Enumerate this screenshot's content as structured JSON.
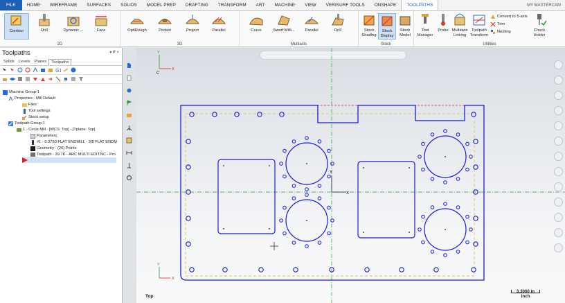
{
  "menubar": {
    "items": [
      "FILE",
      "HOME",
      "WIREFRAME",
      "SURFACES",
      "SOLIDS",
      "MODEL PREP",
      "DRAFTING",
      "TRANSFORM",
      "ART",
      "MACHINE",
      "VIEW",
      "VERISURF TOOLS",
      "ONSHAPE",
      "TOOLPATHS"
    ],
    "account": "MY MASTERCAM"
  },
  "ribbon": {
    "group_2d": {
      "label": "2D",
      "buttons": [
        "Contour",
        "Drill",
        "Dynamic ...",
        "Face"
      ]
    },
    "group_3d": {
      "label": "3D",
      "buttons": [
        "OptiRough",
        "Pocket",
        "Project",
        "Parallel"
      ]
    },
    "group_multiaxis": {
      "label": "Multiaxis",
      "buttons": [
        "Curve",
        "Swarf Milli...",
        "Parallel",
        "Drill"
      ]
    },
    "group_stock": {
      "label": "Stock",
      "buttons": [
        "Stock Shading",
        "Stock Display",
        "Stock Model"
      ]
    },
    "group_utilities": {
      "label": "Utilities",
      "buttons": [
        "Tool Manager",
        "Probe",
        "Multiaxis Linking",
        "Toolpath Transform"
      ],
      "small": [
        "Convert to 5-axis",
        "Trim",
        "Nesting"
      ],
      "check": "Check Holder"
    }
  },
  "left_panel": {
    "title": "Toolpaths",
    "pins": "▾ ₽ ×",
    "tabs": [
      "Solids",
      "Levels",
      "Planes",
      "Toolpaths"
    ],
    "tree": [
      "Machine Group-1",
      "Properties - Mill Default",
      "Files",
      "Tool settings",
      "Stock setup",
      "Toolpath Group-1",
      "1 - Circle Mill - [WCS: Top] - [Tplane: Top]",
      "Parameters",
      "#1 - 0.3750 FLAT ENDMILL - 3/8 FLAT ENDM",
      "Geometry - (26) Points",
      "Toolpath - 39.7K - ARC MULTI EDIT.NC - Pro"
    ]
  },
  "viewport": {
    "view_name": "Top",
    "scale_value": "3.3060 in",
    "scale_unit": "Inch",
    "axis_x": "X",
    "axis_y": "Y",
    "axis_c": "C"
  },
  "colors": {
    "geometry": "#1a1ae0",
    "stock": "#d8d27a",
    "accent": "#1f5fb4",
    "axis_x": "#d42020",
    "axis_y": "#1a9a3a"
  }
}
